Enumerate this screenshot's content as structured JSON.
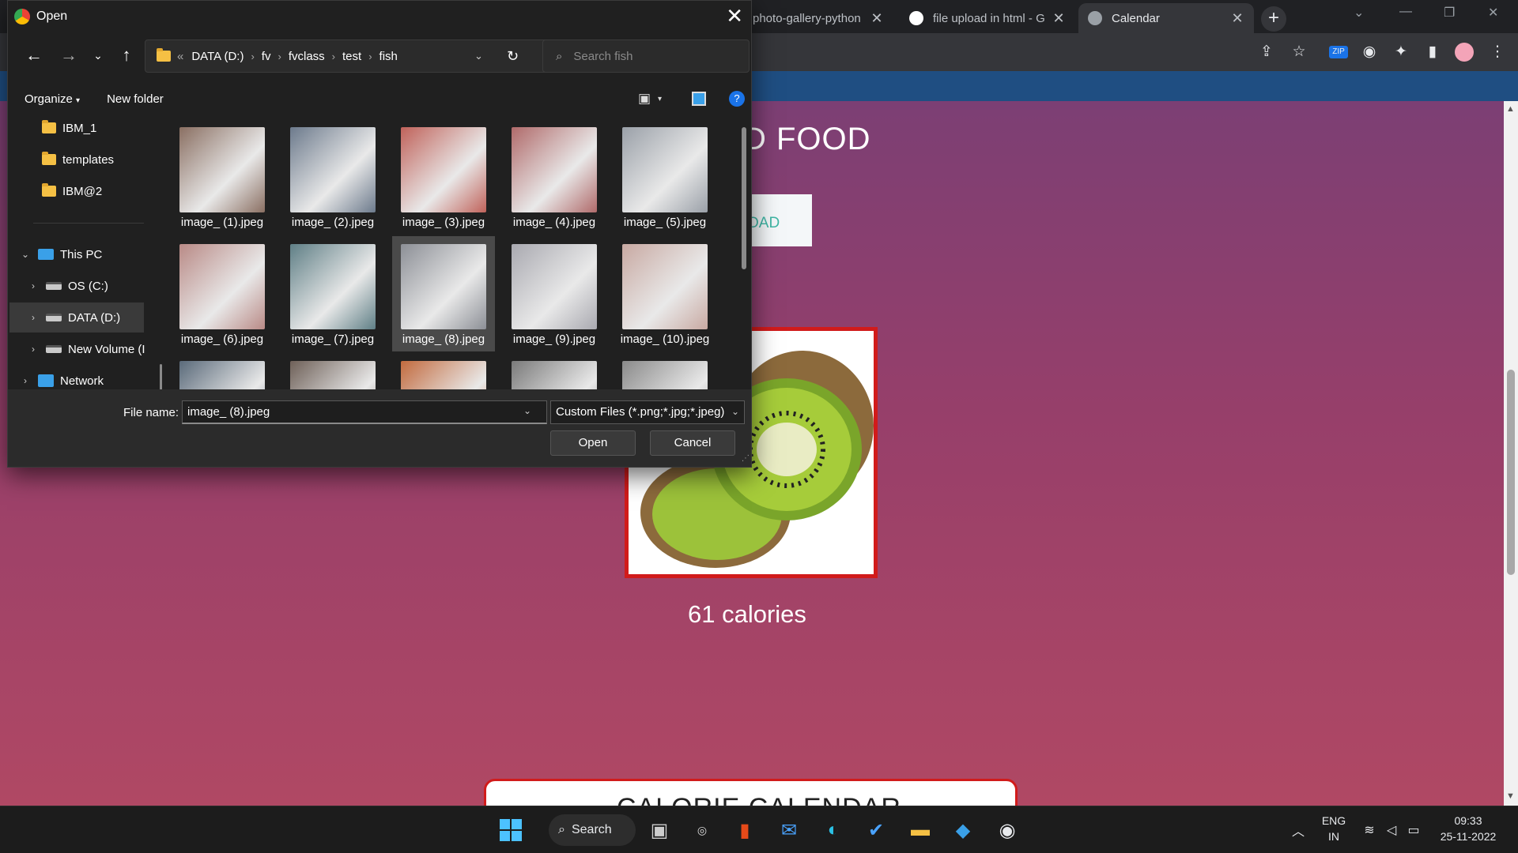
{
  "browser": {
    "tabs": [
      {
        "title": "photo-gallery-python",
        "active": false
      },
      {
        "title": "file upload in html - G",
        "active": false
      },
      {
        "title": "Calendar",
        "active": true
      }
    ],
    "new_tab_label": "+"
  },
  "page": {
    "heading_visible": "D FOOD",
    "upload_button_visible": "OAD",
    "calories_text": "61 calories",
    "calendar_title_visible": "CALORIE CALENDAR"
  },
  "dialog": {
    "title": "Open",
    "address": {
      "overflow": "«",
      "crumbs": [
        "DATA (D:)",
        "fv",
        "fvclass",
        "test",
        "fish"
      ]
    },
    "search_placeholder": "Search fish",
    "toolbar": {
      "organize": "Organize",
      "new_folder": "New folder"
    },
    "nav": [
      {
        "label": "IBM_1",
        "type": "folder"
      },
      {
        "label": "templates",
        "type": "folder"
      },
      {
        "label": "IBM@2",
        "type": "folder"
      },
      {
        "label": "This PC",
        "type": "pc",
        "expanded": true
      },
      {
        "label": "OS (C:)",
        "type": "drive"
      },
      {
        "label": "DATA (D:)",
        "type": "drive",
        "selected": true
      },
      {
        "label": "New Volume (I",
        "type": "drive"
      },
      {
        "label": "Network",
        "type": "network"
      }
    ],
    "files": [
      {
        "name": "image_ (1).jpeg",
        "color": "#8a6f62"
      },
      {
        "name": "image_ (2).jpeg",
        "color": "#6c7a8c"
      },
      {
        "name": "image_ (3).jpeg",
        "color": "#c0625a"
      },
      {
        "name": "image_ (4).jpeg",
        "color": "#b06a6a"
      },
      {
        "name": "image_ (5).jpeg",
        "color": "#9aa0a8"
      },
      {
        "name": "image_ (6).jpeg",
        "color": "#b98a86"
      },
      {
        "name": "image_ (7).jpeg",
        "color": "#5f7f86"
      },
      {
        "name": "image_ (8).jpeg",
        "color": "#8c8f96",
        "selected": true
      },
      {
        "name": "image_ (9).jpeg",
        "color": "#a9a9b0"
      },
      {
        "name": "image_ (10).jpeg",
        "color": "#c8a9a2"
      },
      {
        "name": "",
        "color": "#5a6a7a"
      },
      {
        "name": "",
        "color": "#6e6058"
      },
      {
        "name": "",
        "color": "#c26a3e"
      },
      {
        "name": "",
        "color": "#7a7a7a"
      },
      {
        "name": "",
        "color": "#8a8a8a"
      }
    ],
    "file_name_label": "File name:",
    "file_name_value": "image_ (8).jpeg",
    "filter_value": "Custom Files (*.png;*.jpg;*.jpeg)",
    "open_button": "Open",
    "cancel_button": "Cancel"
  },
  "taskbar": {
    "search_label": "Search",
    "language": "ENG",
    "region": "IN",
    "time": "09:33",
    "date": "25-11-2022"
  }
}
